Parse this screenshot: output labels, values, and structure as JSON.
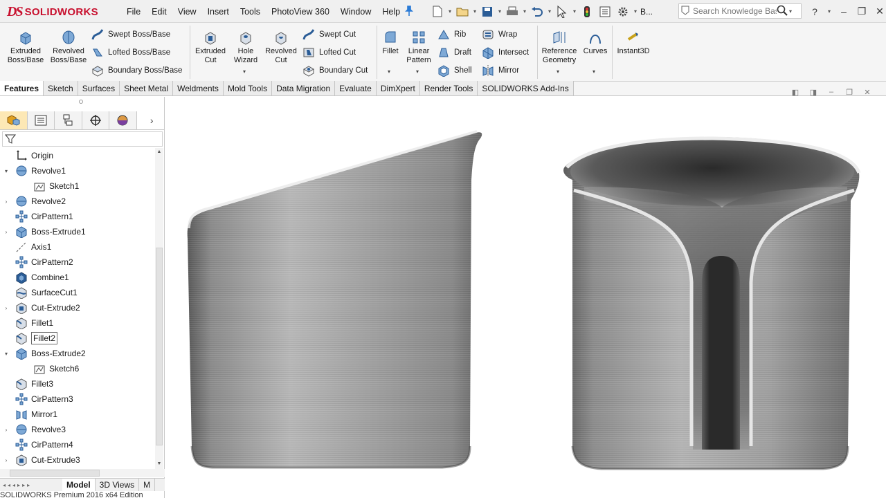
{
  "app": {
    "brand": "SOLIDWORKS",
    "brand_prefix": "DS"
  },
  "menu": [
    "File",
    "Edit",
    "View",
    "Insert",
    "Tools",
    "PhotoView 360",
    "Window",
    "Help"
  ],
  "quickbar": {
    "overflow_label": "B..."
  },
  "search": {
    "placeholder": "Search Knowledge Base"
  },
  "command_manager": {
    "extruded_boss": "Extruded\nBoss/Base",
    "revolved_boss": "Revolved\nBoss/Base",
    "swept_boss": "Swept Boss/Base",
    "lofted_boss": "Lofted Boss/Base",
    "boundary_boss": "Boundary Boss/Base",
    "extruded_cut": "Extruded\nCut",
    "hole_wizard": "Hole\nWizard",
    "revolved_cut": "Revolved\nCut",
    "swept_cut": "Swept Cut",
    "lofted_cut": "Lofted Cut",
    "boundary_cut": "Boundary Cut",
    "fillet": "Fillet",
    "linear_pattern": "Linear\nPattern",
    "rib": "Rib",
    "draft": "Draft",
    "shell": "Shell",
    "wrap": "Wrap",
    "intersect": "Intersect",
    "mirror": "Mirror",
    "reference_geometry": "Reference\nGeometry",
    "curves": "Curves",
    "instant3d": "Instant3D"
  },
  "tabs": [
    "Features",
    "Sketch",
    "Surfaces",
    "Sheet Metal",
    "Weldments",
    "Mold Tools",
    "Data Migration",
    "Evaluate",
    "DimXpert",
    "Render Tools",
    "SOLIDWORKS Add-Ins"
  ],
  "active_tab": "Features",
  "feature_tree": [
    {
      "label": "Origin",
      "icon": "origin-icon",
      "expandable": false,
      "indent": 0
    },
    {
      "label": "Revolve1",
      "icon": "revolve-icon",
      "expandable": true,
      "expanded": true,
      "indent": 0
    },
    {
      "label": "Sketch1",
      "icon": "sketch-icon",
      "expandable": false,
      "indent": 1
    },
    {
      "label": "Revolve2",
      "icon": "revolve-icon",
      "expandable": true,
      "expanded": false,
      "indent": 0
    },
    {
      "label": "CirPattern1",
      "icon": "circular-pattern-icon",
      "expandable": false,
      "indent": 0
    },
    {
      "label": "Boss-Extrude1",
      "icon": "extrude-icon",
      "expandable": true,
      "expanded": false,
      "indent": 0
    },
    {
      "label": "Axis1",
      "icon": "axis-icon",
      "expandable": false,
      "indent": 0
    },
    {
      "label": "CirPattern2",
      "icon": "circular-pattern-icon",
      "expandable": false,
      "indent": 0
    },
    {
      "label": "Combine1",
      "icon": "combine-icon",
      "expandable": false,
      "indent": 0
    },
    {
      "label": "SurfaceCut1",
      "icon": "surface-cut-icon",
      "expandable": false,
      "indent": 0
    },
    {
      "label": "Cut-Extrude2",
      "icon": "cut-extrude-icon",
      "expandable": true,
      "expanded": false,
      "indent": 0
    },
    {
      "label": "Fillet1",
      "icon": "fillet-icon",
      "expandable": false,
      "indent": 0
    },
    {
      "label": "Fillet2",
      "icon": "fillet-icon",
      "expandable": false,
      "indent": 0,
      "selected": true
    },
    {
      "label": "Boss-Extrude2",
      "icon": "extrude-icon",
      "expandable": true,
      "expanded": true,
      "indent": 0
    },
    {
      "label": "Sketch6",
      "icon": "sketch-icon",
      "expandable": false,
      "indent": 1
    },
    {
      "label": "Fillet3",
      "icon": "fillet-icon",
      "expandable": false,
      "indent": 0
    },
    {
      "label": "CirPattern3",
      "icon": "circular-pattern-icon",
      "expandable": false,
      "indent": 0
    },
    {
      "label": "Mirror1",
      "icon": "mirror-icon",
      "expandable": false,
      "indent": 0
    },
    {
      "label": "Revolve3",
      "icon": "revolve-icon",
      "expandable": true,
      "expanded": false,
      "indent": 0
    },
    {
      "label": "CirPattern4",
      "icon": "circular-pattern-icon",
      "expandable": false,
      "indent": 0
    },
    {
      "label": "Cut-Extrude3",
      "icon": "cut-extrude-icon",
      "expandable": true,
      "expanded": false,
      "indent": 0
    }
  ],
  "bottom_tabs": [
    "Model",
    "3D Views",
    "M"
  ],
  "status_bar": "SOLIDWORKS Premium 2016 x64 Edition",
  "colors": {
    "brand_red": "#c8102e",
    "accent_blue": "#2b5d97",
    "model_gray": "#9a9a9a"
  }
}
